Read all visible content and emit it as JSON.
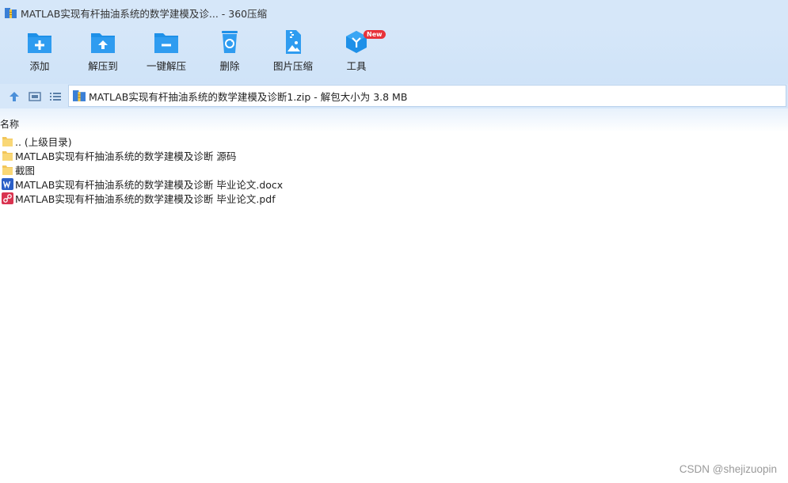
{
  "window": {
    "title": "MATLAB实现有杆抽油系统的数学建模及诊... - 360压缩"
  },
  "toolbar": {
    "add_label": "添加",
    "extract_to_label": "解压到",
    "one_click_extract_label": "一键解压",
    "delete_label": "删除",
    "image_compress_label": "图片压缩",
    "tools_label": "工具",
    "new_badge": "New"
  },
  "address": {
    "text": "MATLAB实现有杆抽油系统的数学建模及诊断1.zip - 解包大小为 3.8 MB"
  },
  "list": {
    "column_name": "名称",
    "items": [
      {
        "label": ".. (上级目录)",
        "icon": "folder-icon"
      },
      {
        "label": "MATLAB实现有杆抽油系统的数学建模及诊断 源码",
        "icon": "folder-icon"
      },
      {
        "label": "截图",
        "icon": "folder-icon"
      },
      {
        "label": "MATLAB实现有杆抽油系统的数学建模及诊断 毕业论文.docx",
        "icon": "word-doc-icon"
      },
      {
        "label": "MATLAB实现有杆抽油系统的数学建模及诊断 毕业论文.pdf",
        "icon": "pdf-doc-icon"
      }
    ]
  },
  "watermark": "CSDN @shejizuopin",
  "colors": {
    "toolbar_bg": "#d6e7f9",
    "icon_blue": "#1e90e8",
    "folder_yellow": "#f9d776",
    "badge_red": "#e8323a"
  }
}
